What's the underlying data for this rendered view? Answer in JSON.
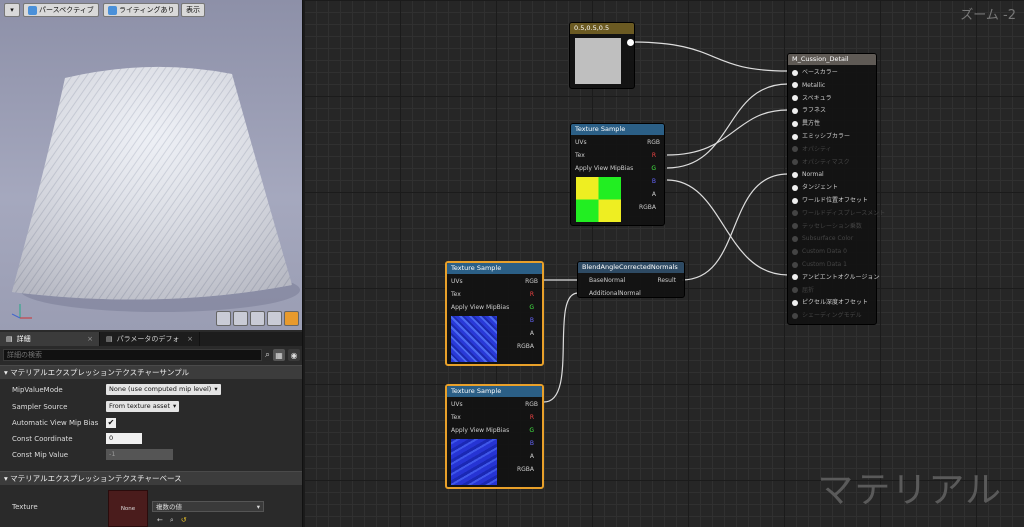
{
  "viewport": {
    "menu_arrow": "▾",
    "perspective_label": "パースペクティブ",
    "lighting_label": "ライティングあり",
    "show_label": "表示",
    "axis_labels": {
      "x": "X",
      "y": "Y",
      "z": "Z"
    }
  },
  "details": {
    "tabs": [
      {
        "label": "詳細",
        "close": "×"
      },
      {
        "label": "パラメータのデフォ",
        "close": "×"
      }
    ],
    "search_placeholder": "詳細の検索",
    "section1": "マテリアルエクスプレッションテクスチャーサンプル",
    "props": [
      {
        "label": "MipValueMode",
        "value": "None (use computed mip level)"
      },
      {
        "label": "Sampler Source",
        "value": "From texture asset"
      },
      {
        "label": "Automatic View Mip Bias",
        "value": "✔"
      },
      {
        "label": "Const Coordinate",
        "value": "0"
      },
      {
        "label": "Const Mip Value",
        "value": "-1"
      }
    ],
    "section2": "マテリアルエクスプレッションテクスチャーベース",
    "texture": {
      "label": "Texture",
      "thumb": "None",
      "value": "複数の値"
    }
  },
  "graph": {
    "zoom": "ズーム -2",
    "watermark": "マテリアル",
    "const_node": {
      "title": "0.5,0.5,0.5"
    },
    "texture_sample_title": "Texture Sample",
    "texture_pins_in": [
      "UVs",
      "Tex",
      "Apply View MipBias"
    ],
    "texture_pins_out": [
      "RGB",
      "R",
      "G",
      "B",
      "A",
      "RGBA"
    ],
    "blend_node": {
      "title": "BlendAngleCorrectedNormals",
      "in1": "BaseNormal",
      "in2": "AdditionalNormal",
      "out": "Result"
    },
    "material_node": {
      "title": "M_Cussion_Detail",
      "pins": [
        {
          "label": "ベースカラー",
          "enabled": true
        },
        {
          "label": "Metallic",
          "enabled": true
        },
        {
          "label": "スペキュラ",
          "enabled": true
        },
        {
          "label": "ラフネス",
          "enabled": true
        },
        {
          "label": "異方性",
          "enabled": true
        },
        {
          "label": "エミッシブカラー",
          "enabled": true
        },
        {
          "label": "オパシティ",
          "enabled": false
        },
        {
          "label": "オパシティマスク",
          "enabled": false
        },
        {
          "label": "Normal",
          "enabled": true
        },
        {
          "label": "タンジェント",
          "enabled": true
        },
        {
          "label": "ワールド位置オフセット",
          "enabled": true
        },
        {
          "label": "ワールドディスプレースメント",
          "enabled": false
        },
        {
          "label": "テッセレーション乗数",
          "enabled": false
        },
        {
          "label": "Subsurface Color",
          "enabled": false
        },
        {
          "label": "Custom Data 0",
          "enabled": false
        },
        {
          "label": "Custom Data 1",
          "enabled": false
        },
        {
          "label": "アンビエントオクルージョン",
          "enabled": true
        },
        {
          "label": "屈折",
          "enabled": false
        },
        {
          "label": "ピクセル深度オフセット",
          "enabled": true
        },
        {
          "label": "シェーディングモデル",
          "enabled": false
        }
      ]
    },
    "colors": {
      "accent": "#e8a02a",
      "texture_header": "#2b5f86",
      "const_header": "#6b5a22",
      "material_header": "#5f5a55"
    }
  }
}
